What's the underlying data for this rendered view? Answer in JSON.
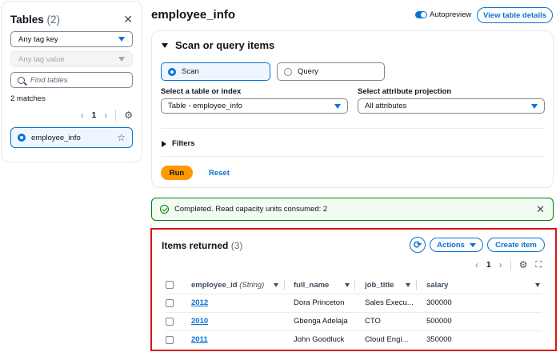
{
  "sidebar": {
    "title": "Tables",
    "count": "(2)",
    "tag_key_label": "Any tag key",
    "tag_value_label": "Any tag value",
    "search_placeholder": "Find tables",
    "matches_text": "2 matches",
    "page_number": "1",
    "tables": [
      {
        "name": "employee_info",
        "selected": true
      }
    ]
  },
  "header": {
    "title": "employee_info",
    "autopreview_label": "Autopreview",
    "autopreview_on": true,
    "view_details_label": "View table details"
  },
  "scan_panel": {
    "title": "Scan or query items",
    "mode_options": [
      {
        "label": "Scan",
        "selected": true
      },
      {
        "label": "Query",
        "selected": false
      }
    ],
    "table_label": "Select a table or index",
    "table_value": "Table - employee_info",
    "projection_label": "Select attribute projection",
    "projection_value": "All attributes",
    "filters_label": "Filters",
    "run_label": "Run",
    "reset_label": "Reset"
  },
  "flash": {
    "message": "Completed. Read capacity units consumed: 2",
    "status_color": "#037f0c"
  },
  "items": {
    "title": "Items returned",
    "count": "(3)",
    "actions_label": "Actions",
    "create_label": "Create item",
    "page_number": "1",
    "columns": {
      "id": "employee_id",
      "id_type": "(String)",
      "name": "full_name",
      "job": "job_title",
      "salary": "salary"
    },
    "rows": [
      {
        "employee_id": "2012",
        "full_name": "Dora Princeton",
        "job_title": "Sales Execu...",
        "salary": "300000"
      },
      {
        "employee_id": "2010",
        "full_name": "Gbenga Adelaja",
        "job_title": "CTO",
        "salary": "500000"
      },
      {
        "employee_id": "2011",
        "full_name": "John Goodluck",
        "job_title": "Cloud Engi...",
        "salary": "350000"
      }
    ]
  },
  "colors": {
    "accent": "#0972d3",
    "run_button": "#ff9900",
    "highlight_border": "#d91515"
  },
  "icons": [
    "close-icon",
    "caret-down-icon",
    "search-icon",
    "chevron-left-icon",
    "chevron-right-icon",
    "gear-icon",
    "star-icon",
    "check-circle-icon",
    "refresh-icon",
    "fullscreen-icon"
  ]
}
